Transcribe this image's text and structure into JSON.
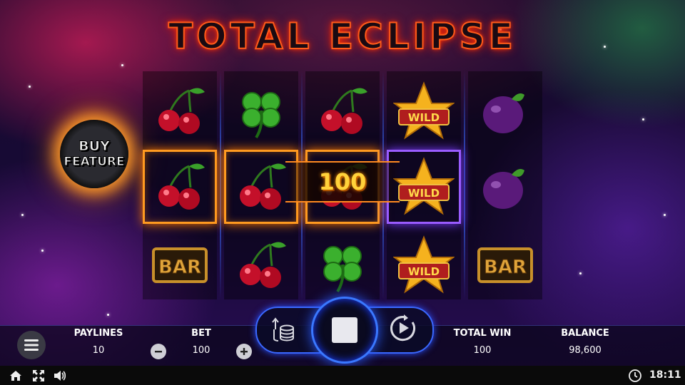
{
  "game": {
    "title": "TOTAL ECLIPSE"
  },
  "buy_feature": {
    "line1": "BUY",
    "line2": "FEATURE"
  },
  "reels": [
    [
      "cherry",
      "cherry",
      "bar"
    ],
    [
      "clover",
      "cherry",
      "cherry"
    ],
    [
      "cherry",
      "cherry",
      "clover"
    ],
    [
      "wild",
      "wild",
      "wild"
    ],
    [
      "plum",
      "plum",
      "bar"
    ]
  ],
  "symbols": {
    "wild_label": "WILD",
    "bar_label": "BAR"
  },
  "win": {
    "amount": "100"
  },
  "paylines": {
    "label": "PAYLINES",
    "value": "10"
  },
  "bet": {
    "label": "BET",
    "value": "100"
  },
  "total_win": {
    "label": "TOTAL WIN",
    "value": "100"
  },
  "balance": {
    "label": "BALANCE",
    "value": "98,600"
  },
  "controls": {
    "menu_icon": "hamburger-menu-icon",
    "bet_icon": "coin-stack-icon",
    "spin_icon": "stop-icon",
    "autoplay_icon": "autoplay-icon"
  },
  "system": {
    "time": "18:11"
  },
  "colors": {
    "accent_blue": "#3a68ff",
    "win_orange": "#ff9a20",
    "title_orange": "#ff5a1a",
    "gold": "#ffd23a"
  }
}
